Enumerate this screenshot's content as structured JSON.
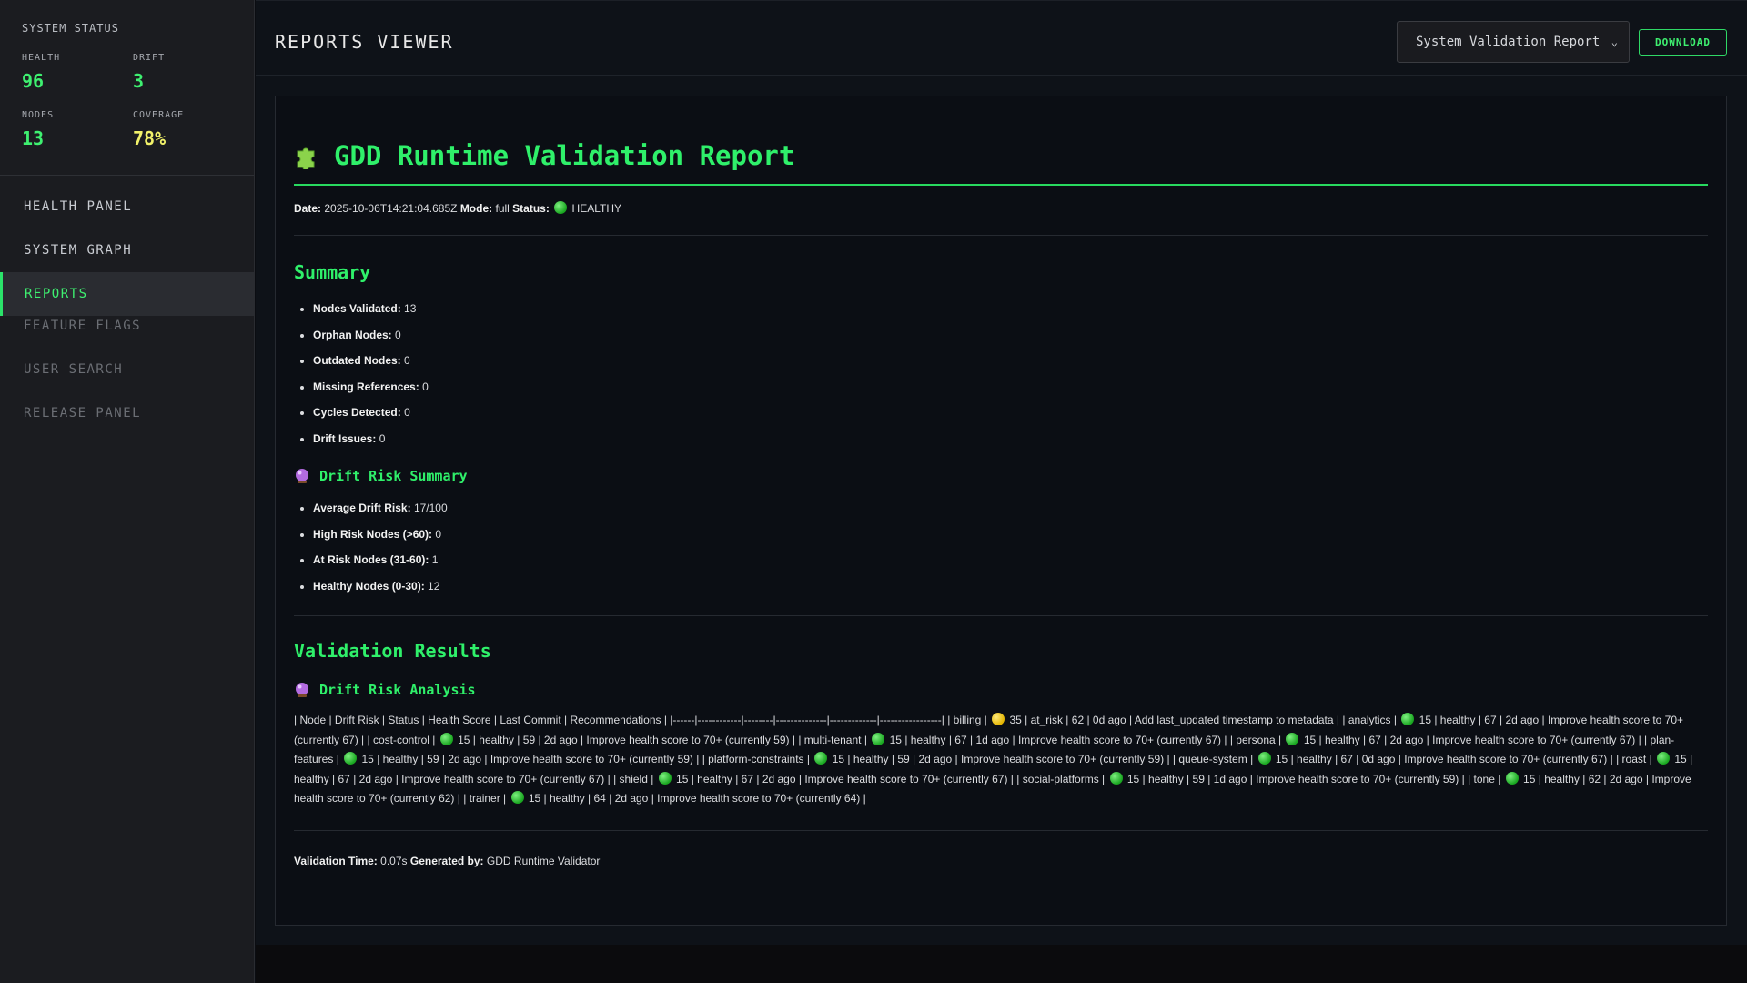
{
  "sidebar": {
    "status_title": "SYSTEM STATUS",
    "metrics": [
      {
        "label": "HEALTH",
        "value": "96",
        "color": "#3ef070"
      },
      {
        "label": "DRIFT",
        "value": "3",
        "color": "#3ef070"
      },
      {
        "label": "NODES",
        "value": "13",
        "color": "#3ef070"
      },
      {
        "label": "COVERAGE",
        "value": "78%",
        "color": "#f2f26a"
      }
    ],
    "nav": [
      {
        "label": "HEALTH PANEL"
      },
      {
        "label": "SYSTEM GRAPH"
      },
      {
        "label": "REPORTS",
        "active": true
      },
      {
        "label": "FEATURE FLAGS"
      },
      {
        "label": "USER SEARCH"
      },
      {
        "label": "RELEASE PANEL"
      }
    ]
  },
  "header": {
    "title": "REPORTS VIEWER",
    "report_select": "System Validation Report",
    "download_label": "DOWNLOAD"
  },
  "report": {
    "title": "GDD Runtime Validation Report",
    "title_icon": "puzzle-icon",
    "meta": {
      "date_label": "Date:",
      "date": "2025-10-06T14:21:04.685Z",
      "mode_label": "Mode:",
      "mode": "full",
      "status_label": "Status:",
      "status": "HEALTHY"
    },
    "summary": {
      "heading": "Summary",
      "items": [
        {
          "label": "Nodes Validated:",
          "value": "13"
        },
        {
          "label": "Orphan Nodes:",
          "value": "0"
        },
        {
          "label": "Outdated Nodes:",
          "value": "0"
        },
        {
          "label": "Missing References:",
          "value": "0"
        },
        {
          "label": "Cycles Detected:",
          "value": "0"
        },
        {
          "label": "Drift Issues:",
          "value": "0"
        }
      ]
    },
    "drift_summary": {
      "heading": "Drift Risk Summary",
      "icon": "crystal-ball-icon",
      "items": [
        {
          "label": "Average Drift Risk:",
          "value": "17/100"
        },
        {
          "label": "High Risk Nodes (>60):",
          "value": "0"
        },
        {
          "label": "At Risk Nodes (31-60):",
          "value": "1"
        },
        {
          "label": "Healthy Nodes (0-30):",
          "value": "12"
        }
      ]
    },
    "validation": {
      "heading": "Validation Results",
      "subheading": "Drift Risk Analysis",
      "header_row": "| Node | Drift Risk | Status | Health Score | Last Commit | Recommendations | |------|------------|--------|--------------|-------------|-----------------| ",
      "rows": [
        {
          "node": "billing",
          "dot": "yellow",
          "risk": "35",
          "status": "at_risk",
          "health": "62",
          "commit": "0d ago",
          "rec": "Add last_updated timestamp to metadata"
        },
        {
          "node": "analytics",
          "dot": "green",
          "risk": "15",
          "status": "healthy",
          "health": "67",
          "commit": "2d ago",
          "rec": "Improve health score to 70+ (currently 67)"
        },
        {
          "node": "cost-control",
          "dot": "green",
          "risk": "15",
          "status": "healthy",
          "health": "59",
          "commit": "2d ago",
          "rec": "Improve health score to 70+ (currently 59)"
        },
        {
          "node": "multi-tenant",
          "dot": "green",
          "risk": "15",
          "status": "healthy",
          "health": "67",
          "commit": "1d ago",
          "rec": "Improve health score to 70+ (currently 67)"
        },
        {
          "node": "persona",
          "dot": "green",
          "risk": "15",
          "status": "healthy",
          "health": "67",
          "commit": "2d ago",
          "rec": "Improve health score to 70+ (currently 67)"
        },
        {
          "node": "plan-features",
          "dot": "green",
          "risk": "15",
          "status": "healthy",
          "health": "59",
          "commit": "2d ago",
          "rec": "Improve health score to 70+ (currently 59)"
        },
        {
          "node": "platform-constraints",
          "dot": "green",
          "risk": "15",
          "status": "healthy",
          "health": "59",
          "commit": "2d ago",
          "rec": "Improve health score to 70+ (currently 59)"
        },
        {
          "node": "queue-system",
          "dot": "green",
          "risk": "15",
          "status": "healthy",
          "health": "67",
          "commit": "0d ago",
          "rec": "Improve health score to 70+ (currently 67)"
        },
        {
          "node": "roast",
          "dot": "green",
          "risk": "15",
          "status": "healthy",
          "health": "67",
          "commit": "2d ago",
          "rec": "Improve health score to 70+ (currently 67)"
        },
        {
          "node": "shield",
          "dot": "green",
          "risk": "15",
          "status": "healthy",
          "health": "67",
          "commit": "2d ago",
          "rec": "Improve health score to 70+ (currently 67)"
        },
        {
          "node": "social-platforms",
          "dot": "green",
          "risk": "15",
          "status": "healthy",
          "health": "59",
          "commit": "1d ago",
          "rec": "Improve health score to 70+ (currently 59)"
        },
        {
          "node": "tone",
          "dot": "green",
          "risk": "15",
          "status": "healthy",
          "health": "62",
          "commit": "2d ago",
          "rec": "Improve health score to 70+ (currently 62)"
        },
        {
          "node": "trainer",
          "dot": "green",
          "risk": "15",
          "status": "healthy",
          "health": "64",
          "commit": "2d ago",
          "rec": "Improve health score to 70+ (currently 64)"
        }
      ]
    },
    "footer": {
      "time_label": "Validation Time:",
      "time": "0.07s",
      "generated_label": "Generated by:",
      "generated": "GDD Runtime Validator"
    }
  }
}
